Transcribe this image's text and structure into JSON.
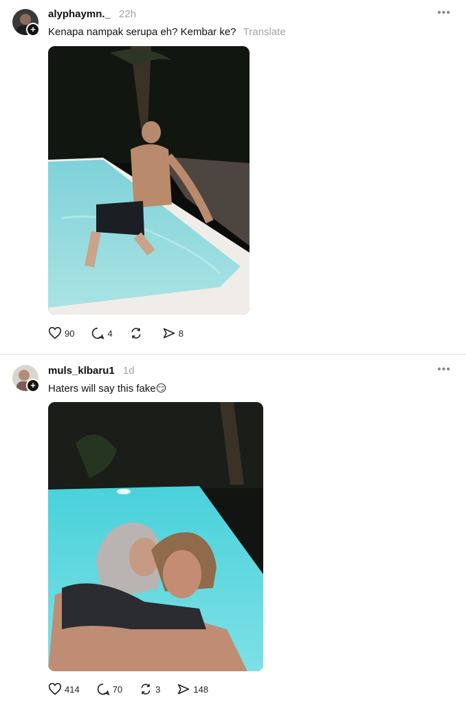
{
  "posts": [
    {
      "username": "alyphaymn._",
      "time": "22h",
      "caption": "Kenapa nampak serupa eh? Kembar ke?",
      "translate": "Translate",
      "photo_alt": "photo",
      "actions": {
        "likes": "90",
        "replies": "4",
        "reposts": "",
        "shares": "8"
      }
    },
    {
      "username": "muls_klbaru1",
      "time": "1d",
      "caption": "Haters will say this fake😏",
      "photo_alt": "photo",
      "actions": {
        "likes": "414",
        "replies": "70",
        "reposts": "3",
        "shares": "148"
      }
    }
  ],
  "icons": {
    "more": "more-icon",
    "like": "heart-icon",
    "reply": "comment-icon",
    "repost": "repost-icon",
    "share": "send-icon",
    "follow": "plus-icon"
  }
}
